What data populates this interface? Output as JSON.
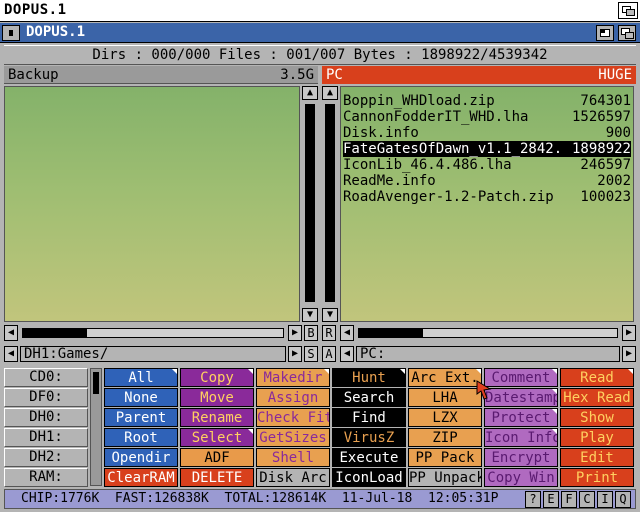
{
  "screen": {
    "title": "DOPUS.1"
  },
  "window": {
    "title": "DOPUS.1"
  },
  "status": {
    "text": "Dirs : 000/000  Files : 001/007  Bytes : 1898922/4539342"
  },
  "left": {
    "name": "Backup",
    "size": "3.5G",
    "path": "DH1:Games/",
    "mid_buttons": [
      "B",
      "S"
    ]
  },
  "right": {
    "name": "PC",
    "size": "HUGE",
    "path": "PC:",
    "mid_buttons": [
      "R",
      "A"
    ],
    "files": [
      {
        "name": "Boppin_WHDload.zip",
        "size": "764301",
        "selected": false
      },
      {
        "name": "CannonFodderIT_WHD.lha",
        "size": "1526597",
        "selected": false
      },
      {
        "name": "Disk.info",
        "size": "900",
        "selected": false
      },
      {
        "name": "FateGatesOfDawn_v1.1_2842.",
        "size": "1898922",
        "selected": true
      },
      {
        "name": "IconLib_46.4.486.lha",
        "size": "246597",
        "selected": false
      },
      {
        "name": "ReadMe.info",
        "size": "2002",
        "selected": false
      },
      {
        "name": "RoadAvenger-1.2-Patch.zip",
        "size": "100023",
        "selected": false
      }
    ]
  },
  "drives": [
    "CD0:",
    "DF0:",
    "DH0:",
    "DH1:",
    "DH2:",
    "RAM:"
  ],
  "button_columns": [
    {
      "bg": "#2f62b8",
      "fg": "#ffffff",
      "labels": [
        "All",
        "None",
        "Parent",
        "Root",
        "Opendir",
        "ClearRAM"
      ],
      "bgs": [
        "#2f62b8",
        "#2f62b8",
        "#2f62b8",
        "#2f62b8",
        "#2f62b8",
        "#d8401c"
      ]
    },
    {
      "bg": "#8a2a9a",
      "fg": "#ffffff",
      "labels": [
        "Copy",
        "Move",
        "Rename",
        "Select",
        "ADF",
        "DELETE"
      ],
      "bgs": [
        "#8a2a9a",
        "#8a2a9a",
        "#8a2a9a",
        "#8a2a9a",
        "#e89a4a",
        "#d8401c"
      ],
      "fgs": [
        "#ffd060",
        "#ffd060",
        "#ffd060",
        "#ffd060",
        "#000000",
        "#ffffff"
      ]
    },
    {
      "bg": "#e8a050",
      "fg": "#8a2a9a",
      "labels": [
        "Makedir",
        "Assign",
        "Check Fit",
        "GetSizes",
        "Shell",
        "Disk Arc"
      ],
      "bgs": [
        "#e8a050",
        "#e8a050",
        "#e8a050",
        "#e8a050",
        "#e8a050",
        "#b4b4b4"
      ],
      "fgs": [
        "#8a2a9a",
        "#8a2a9a",
        "#8a2a9a",
        "#8a2a9a",
        "#8a2a9a",
        "#000000"
      ]
    },
    {
      "bg": "#000000",
      "fg": "#ffa040",
      "labels": [
        "Hunt",
        "Search",
        "Find",
        "VirusZ",
        "Execute",
        "IconLoad"
      ],
      "bgs": [
        "#000000",
        "#000000",
        "#000000",
        "#000000",
        "#000000",
        "#000000"
      ],
      "fgs": [
        "#e8a050",
        "#ffffff",
        "#ffffff",
        "#e8a050",
        "#ffffff",
        "#ffffff"
      ]
    },
    {
      "bg": "#e8a050",
      "fg": "#000000",
      "labels": [
        "Arc Ext.",
        "LHA",
        "LZX",
        "ZIP",
        "PP Pack",
        "PP Unpack"
      ],
      "bgs": [
        "#e8a050",
        "#e8a050",
        "#e8a050",
        "#e8a050",
        "#e8a050",
        "#b4b4b4"
      ]
    },
    {
      "bg": "#b06ac0",
      "fg": "#5a1a70",
      "labels": [
        "Comment",
        "Datestamp",
        "Protect",
        "Icon Info",
        "Encrypt",
        "Copy Win"
      ],
      "bgs": [
        "#b06ac0",
        "#b06ac0",
        "#b06ac0",
        "#b06ac0",
        "#b06ac0",
        "#b06ac0"
      ]
    },
    {
      "bg": "#d8401c",
      "fg": "#ffd060",
      "labels": [
        "Read",
        "Hex Read",
        "Show",
        "Play",
        "Edit",
        "Print"
      ],
      "bgs": [
        "#d8401c",
        "#d8401c",
        "#d8401c",
        "#d8401c",
        "#d8401c",
        "#d8401c"
      ]
    }
  ],
  "bottom": {
    "text": "CHIP:1776K  FAST:126838K  TOTAL:128614K  11-Jul-18  12:05:31P",
    "buttons": [
      "?",
      "E",
      "F",
      "C",
      "I",
      "Q"
    ]
  },
  "icons": {
    "close": "close-icon",
    "depth": "depth-icon",
    "zoom": "zoom-icon",
    "pointer": "mouse-pointer-icon"
  }
}
